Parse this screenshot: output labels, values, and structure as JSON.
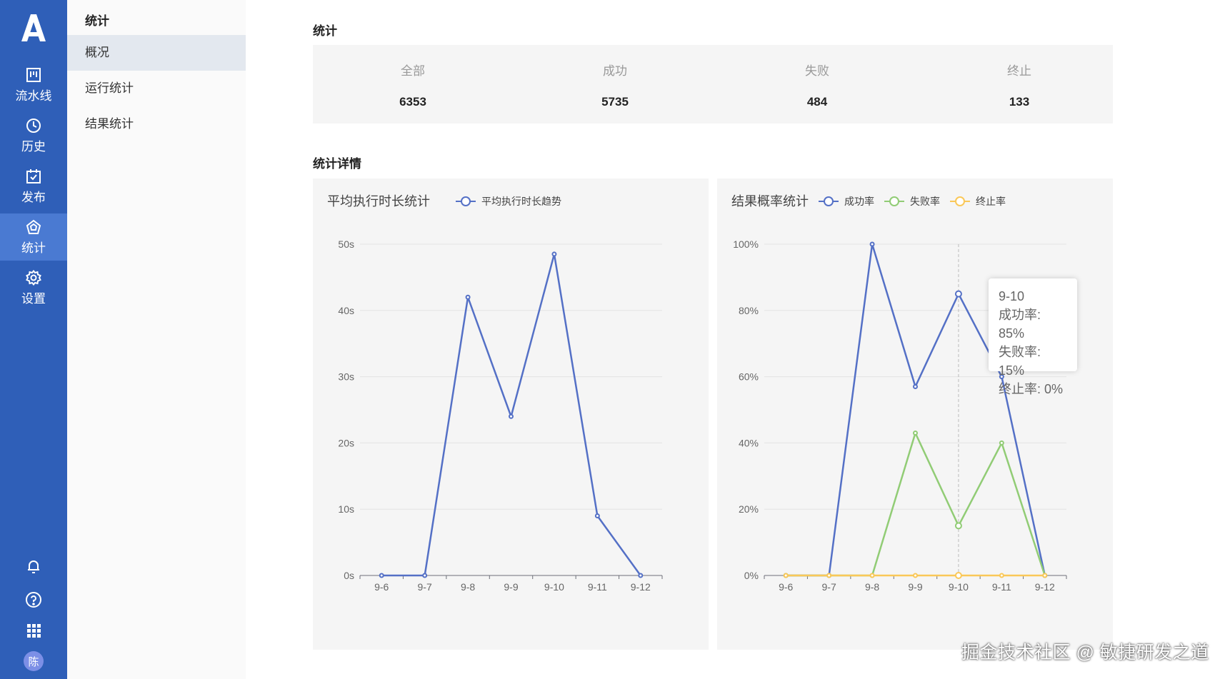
{
  "rail": {
    "items": [
      {
        "label": "流水线",
        "icon": "pipeline-icon"
      },
      {
        "label": "历史",
        "icon": "clock-icon"
      },
      {
        "label": "发布",
        "icon": "calendar-check-icon"
      },
      {
        "label": "统计",
        "icon": "pentagon-chart-icon",
        "active": true
      },
      {
        "label": "设置",
        "icon": "gear-icon"
      }
    ],
    "bottom_icons": [
      "bell-icon",
      "help-icon",
      "apps-grid-icon"
    ],
    "avatar": "陈",
    "accent": "#2f5fb8",
    "active_bg": "#4a7ad2"
  },
  "submenu": {
    "title": "统计",
    "items": [
      {
        "label": "概况",
        "active": true
      },
      {
        "label": "运行统计"
      },
      {
        "label": "结果统计"
      }
    ]
  },
  "main": {
    "stats_title": "统计",
    "stats": [
      {
        "label": "全部",
        "value": "6353"
      },
      {
        "label": "成功",
        "value": "5735"
      },
      {
        "label": "失败",
        "value": "484"
      },
      {
        "label": "终止",
        "value": "133"
      }
    ],
    "details_title": "统计详情"
  },
  "tooltip": {
    "title": "9-10",
    "lines": [
      "成功率: 85%",
      "失败率: 15%",
      "终止率: 0%"
    ]
  },
  "watermark": "掘金技术社区 @ 敏捷研发之道",
  "chart_data": [
    {
      "type": "line",
      "title": "平均执行时长统计",
      "categories": [
        "9-6",
        "9-7",
        "9-8",
        "9-9",
        "9-10",
        "9-11",
        "9-12"
      ],
      "yticks": [
        "0s",
        "10s",
        "20s",
        "30s",
        "40s",
        "50s"
      ],
      "ylim": [
        0,
        50
      ],
      "grid": true,
      "legend": "top",
      "series": [
        {
          "name": "平均执行时长趋势",
          "color": "#5470c6",
          "values": [
            0,
            0,
            42,
            24,
            48.5,
            9,
            0
          ]
        }
      ]
    },
    {
      "type": "line",
      "title": "结果概率统计",
      "categories": [
        "9-6",
        "9-7",
        "9-8",
        "9-9",
        "9-10",
        "9-11",
        "9-12"
      ],
      "yticks": [
        "0%",
        "20%",
        "40%",
        "60%",
        "80%",
        "100%"
      ],
      "ylim": [
        0,
        100
      ],
      "grid": true,
      "legend": "top",
      "series": [
        {
          "name": "成功率",
          "color": "#5470c6",
          "values": [
            0,
            0,
            100,
            57,
            85,
            60,
            0
          ]
        },
        {
          "name": "失败率",
          "color": "#91cc75",
          "values": [
            0,
            0,
            0,
            43,
            15,
            40,
            0
          ]
        },
        {
          "name": "终止率",
          "color": "#fac858",
          "values": [
            0,
            0,
            0,
            0,
            0,
            0,
            0
          ]
        }
      ]
    }
  ]
}
